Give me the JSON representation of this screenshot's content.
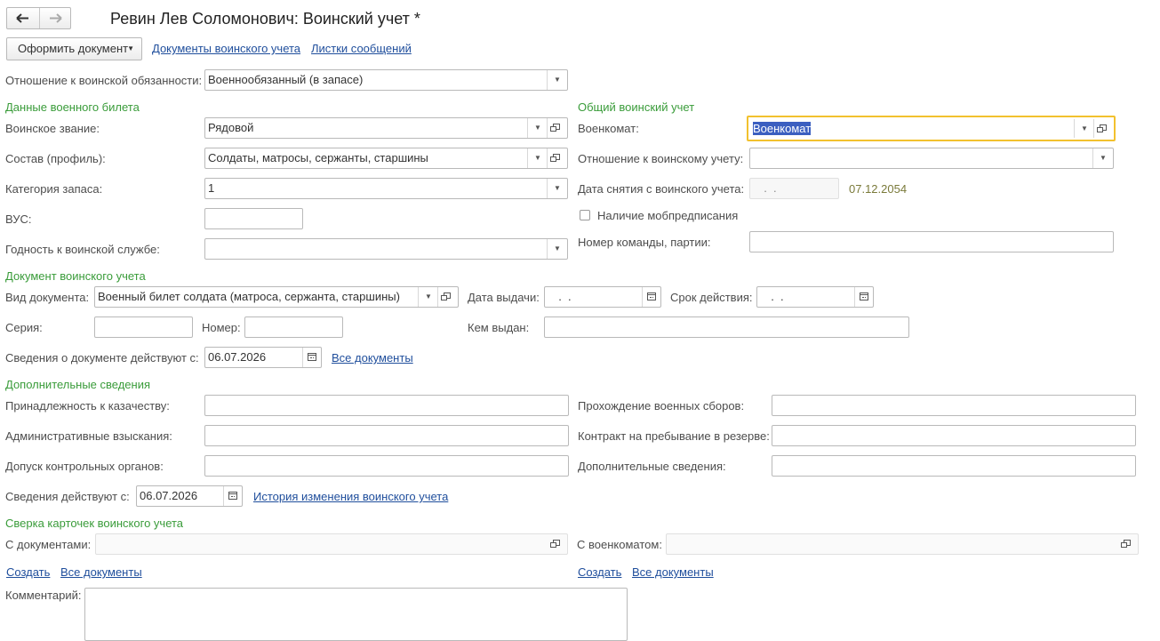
{
  "window": {
    "title": "Ревин Лев Соломонович: Воинский учет *"
  },
  "nav": {
    "back_icon": "arrow-left-icon",
    "forward_icon": "arrow-right-icon"
  },
  "toolbar": {
    "create_doc_label": "Оформить документ",
    "link_military_docs": "Документы воинского учета",
    "link_messages": "Листки сообщений"
  },
  "duty": {
    "label": "Отношение к воинской обязанности:",
    "value": "Военнообязанный (в запасе)"
  },
  "ticket": {
    "section": "Данные военного билета",
    "rank_label": "Воинское звание:",
    "rank_value": "Рядовой",
    "profile_label": "Состав (профиль):",
    "profile_value": "Солдаты, матросы, сержанты, старшины",
    "reserve_label": "Категория запаса:",
    "reserve_value": "1",
    "vus_label": "ВУС:",
    "vus_value": "",
    "fitness_label": "Годность к воинской службе:",
    "fitness_value": ""
  },
  "general": {
    "section": "Общий воинский учет",
    "office_label": "Военкомат:",
    "office_value": "Военкомат",
    "attitude_label": "Отношение к воинскому учету:",
    "attitude_value": "",
    "removal_label": "Дата снятия с воинского учета:",
    "removal_value": "  .  .",
    "removal_hint": "07.12.2054",
    "mob_label": "Наличие мобпредписания",
    "team_label": "Номер команды, партии:",
    "team_value": ""
  },
  "document": {
    "section": "Документ воинского учета",
    "type_label": "Вид документа:",
    "type_value": "Военный билет солдата (матроса, сержанта, старшины)",
    "issue_label": "Дата выдачи:",
    "issue_value": "  .  .",
    "valid_label": "Срок действия:",
    "valid_value": "  .  .",
    "series_label": "Серия:",
    "series_value": "",
    "number_label": "Номер:",
    "number_value": "",
    "issuer_label": "Кем выдан:",
    "issuer_value": "",
    "since_label": "Сведения о документе действуют с:",
    "since_value": "06.07.2026",
    "all_docs_link": "Все документы"
  },
  "extra": {
    "section": "Дополнительные сведения",
    "cossack_label": "Принадлежность к казачеству:",
    "training_label": "Прохождение военных сборов:",
    "penalties_label": "Административные взыскания:",
    "contract_label": "Контракт на пребывание в резерве:",
    "access_label": "Допуск контрольных органов:",
    "additional_label": "Дополнительные сведения:",
    "since_label": "Сведения действуют с:",
    "since_value": "06.07.2026",
    "history_link": "История изменения воинского учета"
  },
  "reconcile": {
    "section": "Сверка карточек воинского учета",
    "docs_label": "С документами:",
    "office_label": "С военкоматом:",
    "create_link": "Создать",
    "all_docs_link": "Все документы"
  },
  "comment": {
    "label": "Комментарий:",
    "value": ""
  },
  "colors": {
    "section": "#3a9c3a",
    "link": "#1f4e9c",
    "focus": "#f2c12e",
    "selection": "#3b5fc0"
  }
}
